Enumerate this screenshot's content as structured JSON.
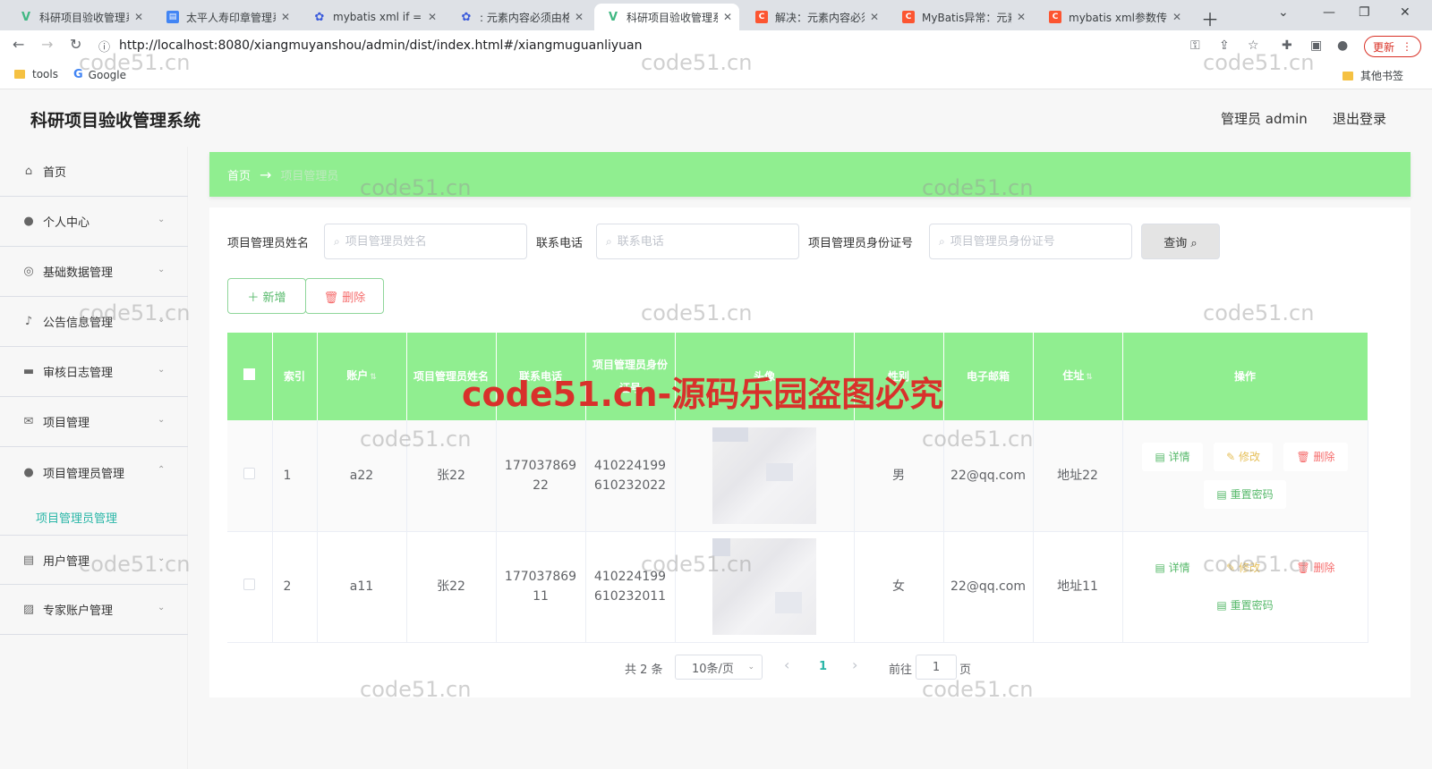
{
  "browser": {
    "tabs": [
      {
        "title": "科研项目验收管理系",
        "favicon_color": "#41b883",
        "favicon_glyph": "V",
        "active": false
      },
      {
        "title": "太平人寿印章管理系",
        "favicon_color": "#4285f4",
        "favicon_glyph": "▤",
        "active": false
      },
      {
        "title": "mybatis xml if ==",
        "favicon_color": "#3b5bdb",
        "favicon_glyph": "✿",
        "active": false
      },
      {
        "title": ": 元素内容必须由格",
        "favicon_color": "#3b5bdb",
        "favicon_glyph": "✿",
        "active": false
      },
      {
        "title": "科研项目验收管理系",
        "favicon_color": "#41b883",
        "favicon_glyph": "V",
        "active": true
      },
      {
        "title": "解决：元素内容必须",
        "favicon_color": "#fc5531",
        "favicon_glyph": "C",
        "active": false
      },
      {
        "title": "MyBatis异常：元素",
        "favicon_color": "#fc5531",
        "favicon_glyph": "C",
        "active": false
      },
      {
        "title": "mybatis xml参数传",
        "favicon_color": "#fc5531",
        "favicon_glyph": "C",
        "active": false
      }
    ],
    "url": "http://localhost:8080/xiangmuyanshou/admin/dist/index.html#/xiangmuguanliyuan",
    "update_label": "更新",
    "bookmarks": [
      {
        "label": "tools"
      },
      {
        "label": "Google"
      }
    ],
    "other_bookmarks": "其他书签"
  },
  "app": {
    "title": "科研项目验收管理系统",
    "admin_label": "管理员 admin",
    "logout_label": "退出登录"
  },
  "sidebar": {
    "items": [
      {
        "label": "首页",
        "icon": "home-icon",
        "glyph": "⌂",
        "expandable": false
      },
      {
        "label": "个人中心",
        "icon": "user-icon",
        "glyph": "●",
        "expandable": true
      },
      {
        "label": "基础数据管理",
        "icon": "compass-icon",
        "glyph": "◎",
        "expandable": true
      },
      {
        "label": "公告信息管理",
        "icon": "microphone-icon",
        "glyph": "♪",
        "expandable": true
      },
      {
        "label": "审核日志管理",
        "icon": "briefcase-icon",
        "glyph": "▬",
        "expandable": true
      },
      {
        "label": "项目管理",
        "icon": "message-icon",
        "glyph": "✉",
        "expandable": true
      },
      {
        "label": "项目管理员管理",
        "icon": "user-solid-icon",
        "glyph": "●",
        "expandable": true,
        "expanded": true
      },
      {
        "label": "用户管理",
        "icon": "document-icon",
        "glyph": "▤",
        "expandable": true
      },
      {
        "label": "专家账户管理",
        "icon": "data-line-icon",
        "glyph": "▨",
        "expandable": true
      }
    ],
    "submenu": {
      "label": "项目管理员管理"
    }
  },
  "breadcrumb": {
    "home": "首页",
    "separator": "→",
    "current": "项目管理员"
  },
  "search": {
    "name_label": "项目管理员姓名",
    "name_placeholder": "项目管理员姓名",
    "phone_label": "联系电话",
    "phone_placeholder": "联系电话",
    "idcard_label": "项目管理员身份证号",
    "idcard_placeholder": "项目管理员身份证号",
    "query_label": "查询 ⌕"
  },
  "actions": {
    "add_label": "＋ 新增",
    "delete_label": "🗑 删除"
  },
  "table": {
    "headers": {
      "index": "索引",
      "account": "账户",
      "name": "项目管理员姓名",
      "phone": "联系电话",
      "idcard": "项目管理员身份证号",
      "avatar": "头像",
      "gender": "性别",
      "email": "电子邮箱",
      "address": "住址",
      "ops": "操作"
    },
    "rows": [
      {
        "index": "1",
        "account": "a22",
        "name": "张22",
        "phone": "17703786922",
        "idcard": "410224199610232022",
        "gender": "男",
        "email": "22@qq.com",
        "address": "地址22"
      },
      {
        "index": "2",
        "account": "a11",
        "name": "张22",
        "phone": "17703786911",
        "idcard": "410224199610232011",
        "gender": "女",
        "email": "22@qq.com",
        "address": "地址11"
      }
    ],
    "op_labels": {
      "detail": "详情",
      "edit": "修改",
      "delete": "删除",
      "reset": "重置密码"
    }
  },
  "pagination": {
    "total": "共 2 条",
    "page_size": "10条/页",
    "prev": "‹",
    "current": "1",
    "next": "›",
    "goto_label": "前往",
    "goto_value": "1",
    "page_suffix": "页"
  },
  "watermark": {
    "small": "code51.cn",
    "big": "code51.cn-源码乐园盗图必究"
  },
  "colors": {
    "accent_green": "#90ee90",
    "active_submenu": "#29b6a7",
    "danger": "#f56c6c",
    "success": "#56b96a"
  }
}
